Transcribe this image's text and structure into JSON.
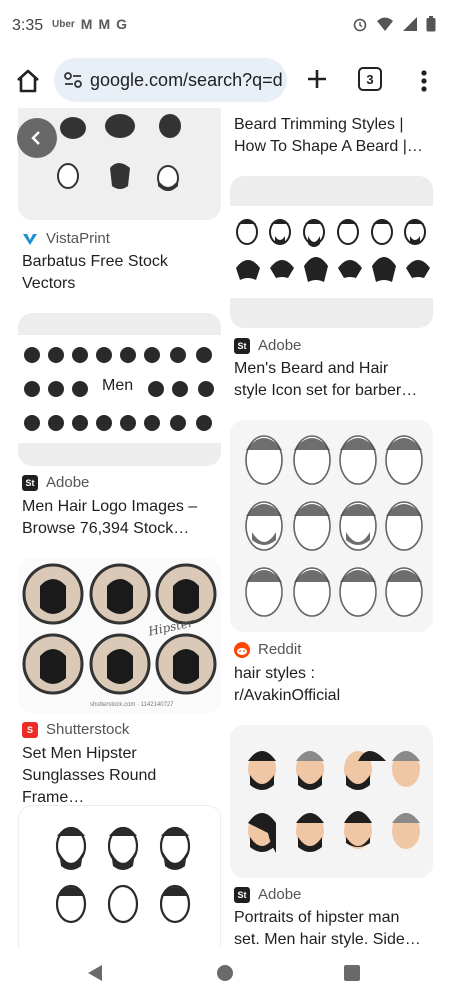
{
  "status": {
    "time": "3:35",
    "apps": [
      "Uber",
      "M",
      "M",
      "G"
    ]
  },
  "toolbar": {
    "url": "google.com/search?q=d",
    "tab_count": "3"
  },
  "results": [
    {
      "source": "VistaPrint",
      "title_1": "Barbatus Free Stock",
      "title_2": "Vectors"
    },
    {
      "source": "Adobe",
      "title_1": "Men Hair Logo Images –",
      "title_2": "Browse 76,394 Stock…"
    },
    {
      "source": "Shutterstock",
      "title_1": "Set Men Hipster",
      "title_2": "Sunglasses Round Frame…"
    },
    {
      "title_1": "Beard Trimming Styles |",
      "title_2": "How To Shape A Beard |…"
    },
    {
      "source": "Adobe",
      "title_1": "Men's Beard and Hair",
      "title_2": "style Icon set for barber…"
    },
    {
      "source": "Reddit",
      "title_1": "hair styles :",
      "title_2": "r/AvakinOfficial"
    },
    {
      "source": "Adobe",
      "title_1": "Portraits of hipster man",
      "title_2": "set. Men hair style. Side…"
    }
  ],
  "image_texts": {
    "men_label": "Men",
    "shutter_watermark": "shutterstock.com · 1142140727",
    "hipster_script": "Hipster"
  },
  "colors": {
    "accent_omnibox": "#e8eff7",
    "adobe_badge": "#1f1f1f",
    "reddit": "#ff4500",
    "shutterstock": "#ee2b24",
    "vistaprint": "#1a8fd1"
  }
}
